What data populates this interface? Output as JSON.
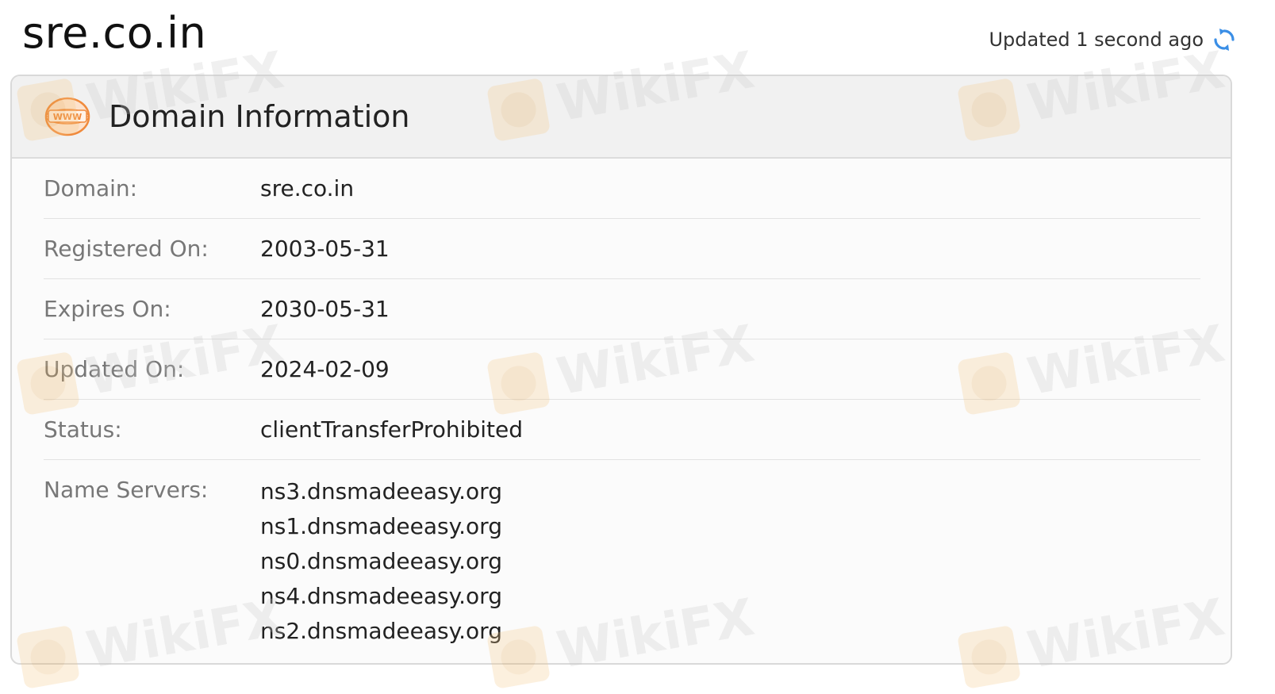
{
  "page": {
    "title": "sre.co.in",
    "updated_text": "Updated 1 second ago"
  },
  "card": {
    "title": "Domain Information",
    "icon_text": "WWW",
    "rows": [
      {
        "label": "Domain:",
        "value": "sre.co.in"
      },
      {
        "label": "Registered On:",
        "value": "2003-05-31"
      },
      {
        "label": "Expires On:",
        "value": "2030-05-31"
      },
      {
        "label": "Updated On:",
        "value": "2024-02-09"
      },
      {
        "label": "Status:",
        "value": "clientTransferProhibited"
      }
    ],
    "name_servers": {
      "label": "Name Servers:",
      "values": [
        "ns3.dnsmadeeasy.org",
        "ns1.dnsmadeeasy.org",
        "ns0.dnsmadeeasy.org",
        "ns4.dnsmadeeasy.org",
        "ns2.dnsmadeeasy.org"
      ]
    }
  },
  "watermark": {
    "text": "WikiFX"
  },
  "colors": {
    "accent_blue": "#3a8ee6",
    "www_orange": "#f08a3c",
    "watermark_orange": "#f5c98a"
  },
  "icons": {
    "refresh": "refresh-icon",
    "www": "www-globe-icon"
  }
}
